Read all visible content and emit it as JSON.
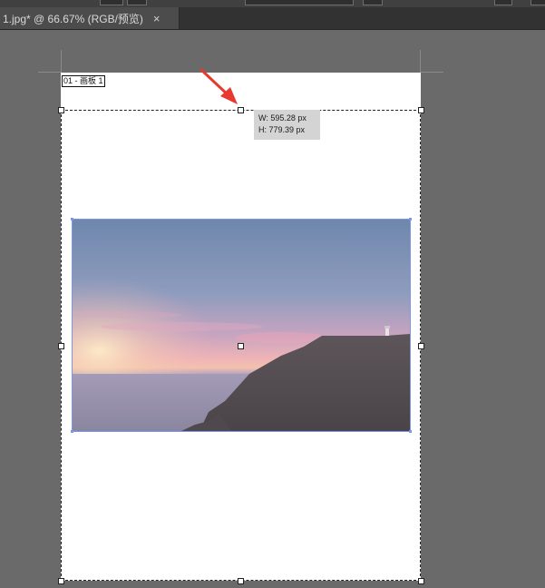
{
  "tab": {
    "title": "1.jpg* @ 66.67% (RGB/预览)",
    "close_glyph": "×"
  },
  "artboard": {
    "label": "01 - 画板 1"
  },
  "transform_tooltip": {
    "width": "W: 595.28 px",
    "height": "H: 779.39 px"
  },
  "colors": {
    "workspace_bg": "#6a6a6a",
    "artboard_bg": "#ffffff",
    "selection_accent": "#7d96e8",
    "annotation_arrow": "#e8392f"
  },
  "icons": {
    "close": "close-icon",
    "annotation": "arrow-annotation"
  }
}
